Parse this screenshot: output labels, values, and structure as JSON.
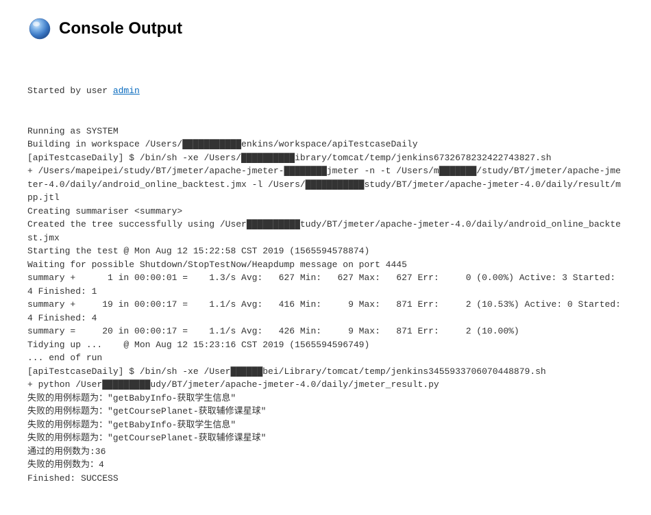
{
  "header": {
    "title": "Console Output"
  },
  "console": {
    "prefix_line_0": "Started by user ",
    "user_link": "admin",
    "lines": [
      "Running as SYSTEM",
      "Building in workspace /Users/███████████enkins/workspace/apiTestcaseDaily",
      "[apiTestcaseDaily] $ /bin/sh -xe /Users/██████████ibrary/tomcat/temp/jenkins6732678232422743827.sh",
      "+ /Users/mapeipei/study/BT/jmeter/apache-jmeter-████████jmeter -n -t /Users/m███████/study/BT/jmeter/apache-jmeter-4.0/daily/android_online_backtest.jmx -l /Users/███████████study/BT/jmeter/apache-jmeter-4.0/daily/result/mpp.jtl",
      "Creating summariser <summary>",
      "Created the tree successfully using /User██████████tudy/BT/jmeter/apache-jmeter-4.0/daily/android_online_backtest.jmx",
      "Starting the test @ Mon Aug 12 15:22:58 CST 2019 (1565594578874)",
      "Waiting for possible Shutdown/StopTestNow/Heapdump message on port 4445",
      "summary +      1 in 00:00:01 =    1.3/s Avg:   627 Min:   627 Max:   627 Err:     0 (0.00%) Active: 3 Started: 4 Finished: 1",
      "summary +     19 in 00:00:17 =    1.1/s Avg:   416 Min:     9 Max:   871 Err:     2 (10.53%) Active: 0 Started: 4 Finished: 4",
      "summary =     20 in 00:00:17 =    1.1/s Avg:   426 Min:     9 Max:   871 Err:     2 (10.00%)",
      "Tidying up ...    @ Mon Aug 12 15:23:16 CST 2019 (1565594596749)",
      "... end of run",
      "[apiTestcaseDaily] $ /bin/sh -xe /User██████bei/Library/tomcat/temp/jenkins3455933706070448879.sh",
      "+ python /User█████████udy/BT/jmeter/apache-jmeter-4.0/daily/jmeter_result.py",
      "失败的用例标题为：\"getBabyInfo-获取学生信息\"",
      "失败的用例标题为：\"getCoursePlanet-获取辅修课星球\"",
      "失败的用例标题为：\"getBabyInfo-获取学生信息\"",
      "失败的用例标题为：\"getCoursePlanet-获取辅修课星球\"",
      "通过的用例数为:36",
      "失败的用例数为：4",
      "Finished: SUCCESS"
    ]
  }
}
